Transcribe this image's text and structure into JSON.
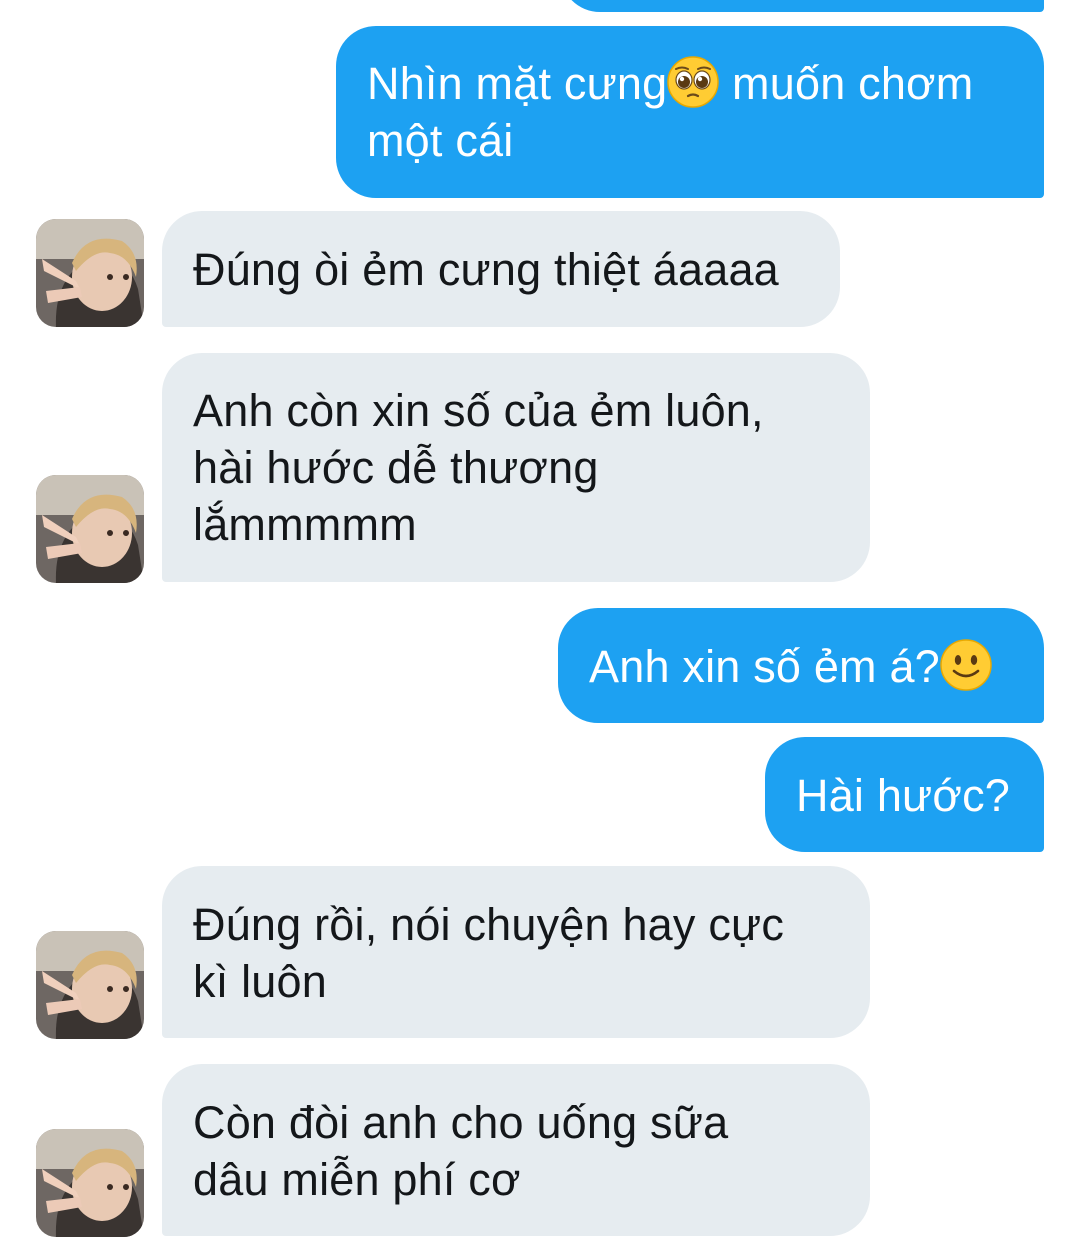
{
  "conversation": {
    "messages": [
      {
        "direction": "sent",
        "text": "Nhìn mặt cưng",
        "emoji": "pleading-face",
        "text_after": " muốn chơm một cái"
      },
      {
        "direction": "received",
        "text": "Đúng òi ẻm cưng thiệt áaaaa"
      },
      {
        "direction": "received",
        "text": "Anh còn xin số của ẻm luôn, hài hước dễ thương lắmmmmm"
      },
      {
        "direction": "sent",
        "text": "Anh xin số ẻm á?",
        "emoji": "slightly-smiling-face"
      },
      {
        "direction": "sent",
        "text": "Hài hước?"
      },
      {
        "direction": "received",
        "text": "Đúng rồi, nói chuyện hay cực kì luôn"
      },
      {
        "direction": "received",
        "text": "Còn đòi anh cho uống sữa dâu miễn phí cơ"
      }
    ]
  },
  "colors": {
    "sent_bubble": "#1da1f2",
    "received_bubble": "#e6ecf0",
    "sent_text": "#ffffff",
    "received_text": "#14171a"
  }
}
